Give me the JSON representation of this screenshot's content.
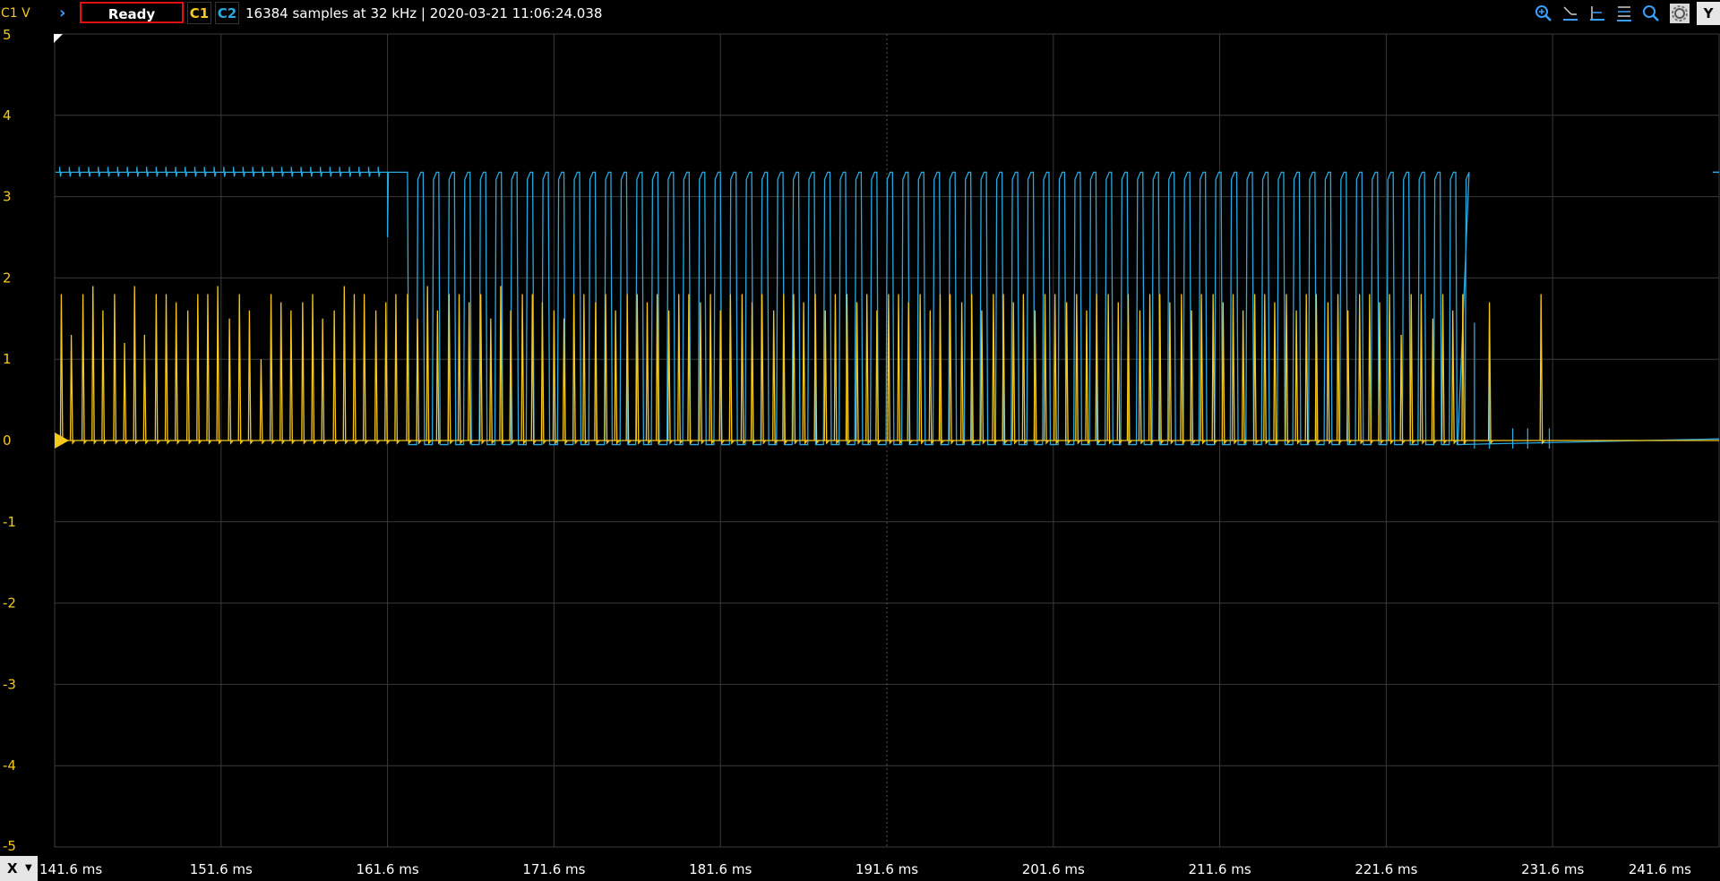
{
  "toolbar": {
    "channel_unit_label": "C1 V",
    "status_label": "Ready",
    "c1_label": "C1",
    "c2_label": "C2",
    "acquisition_info": "16384 samples at 32 kHz | 2020-03-21 11:06:24.038",
    "icons": [
      "zoom-in-icon",
      "cursor-icon",
      "marker-icon",
      "list-icon",
      "search-icon",
      "settings-icon"
    ],
    "y_button_label": "Y",
    "x_button_label": "X"
  },
  "colors": {
    "c1": "#f5c81e",
    "c2": "#29a9e0",
    "grid": "#3a3a3a",
    "status_border": "#e01010"
  },
  "chart_data": {
    "type": "line",
    "xlabel": "",
    "ylabel": "C1 V",
    "ylim": [
      -5,
      5
    ],
    "xlim": [
      141.6,
      241.6
    ],
    "yticks": [
      5,
      4,
      3,
      2,
      1,
      0,
      -1,
      -2,
      -3,
      -4,
      -5
    ],
    "xticks": [
      "141.6 ms",
      "151.6 ms",
      "161.6 ms",
      "171.6 ms",
      "181.6 ms",
      "191.6 ms",
      "201.6 ms",
      "211.6 ms",
      "221.6 ms",
      "231.6 ms",
      "241.6 ms"
    ],
    "grid": true,
    "series": [
      {
        "channel": "C1",
        "baseline": 0,
        "pulse_times_ms": [
          142.0,
          142.6,
          143.3,
          143.9,
          144.5,
          145.2,
          145.8,
          146.4,
          147.0,
          147.7,
          148.3,
          148.9,
          149.6,
          150.2,
          150.8,
          151.4,
          152.1,
          152.7,
          153.3,
          154.0,
          154.6,
          155.2,
          155.8,
          156.5,
          157.1,
          157.7,
          158.4,
          159.0,
          159.6,
          160.2,
          160.9,
          161.5,
          162.1,
          162.8,
          163.4,
          164.0,
          164.6,
          165.3,
          165.9,
          166.5,
          167.2,
          167.8,
          168.4,
          169.0,
          169.7,
          170.3,
          170.9,
          171.6,
          172.2,
          172.8,
          173.4,
          174.1,
          174.7,
          175.3,
          176.0,
          176.6,
          177.2,
          177.8,
          178.5,
          179.1,
          179.7,
          180.4,
          181.0,
          181.6,
          182.2,
          182.9,
          183.5,
          184.1,
          184.8,
          185.4,
          186.0,
          186.6,
          187.3,
          187.9,
          188.5,
          189.2,
          189.8,
          190.4,
          191.0,
          191.7,
          192.3,
          192.9,
          193.6,
          194.2,
          194.8,
          195.4,
          196.1,
          196.7,
          197.3,
          198.0,
          198.6,
          199.2,
          199.8,
          200.5,
          201.1,
          201.7,
          202.4,
          203.0,
          203.6,
          204.2,
          204.9,
          205.5,
          206.1,
          206.8,
          207.4,
          208.0,
          208.6,
          209.3,
          209.9,
          210.5,
          211.2,
          211.8,
          212.4,
          213.0,
          213.7,
          214.3,
          214.9,
          215.6,
          216.2,
          216.8,
          217.4,
          218.1,
          218.7,
          219.3,
          220.0,
          220.6,
          221.2,
          221.8,
          222.5,
          223.1,
          223.7,
          224.4,
          225.0,
          225.6,
          226.2,
          227.8,
          230.9
        ],
        "pulse_peaks_v": [
          1.8,
          1.3,
          1.8,
          1.9,
          1.6,
          1.8,
          1.2,
          1.9,
          1.3,
          1.8,
          1.8,
          1.7,
          1.6,
          1.8,
          1.8,
          1.9,
          1.5,
          1.8,
          1.6,
          1.0,
          1.8,
          1.7,
          1.6,
          1.7,
          1.8,
          1.5,
          1.6,
          1.9,
          1.8,
          1.8,
          1.6,
          1.7,
          1.8,
          1.8,
          1.5,
          1.9,
          1.6,
          1.8,
          1.8,
          1.7,
          1.8,
          1.5,
          1.9,
          1.6,
          1.8,
          1.8,
          1.7,
          1.6,
          1.5,
          1.8,
          1.8,
          1.7,
          1.8,
          1.6,
          1.8,
          1.8,
          1.7,
          1.8,
          1.6,
          1.8,
          1.8,
          1.7,
          1.8,
          1.6,
          1.8,
          1.8,
          1.7,
          1.8,
          1.6,
          1.8,
          1.8,
          1.7,
          1.8,
          1.6,
          1.8,
          1.8,
          1.7,
          1.8,
          1.6,
          1.8,
          1.8,
          1.7,
          1.8,
          1.6,
          1.8,
          1.8,
          1.7,
          1.8,
          1.6,
          1.8,
          1.8,
          1.7,
          1.8,
          1.6,
          1.8,
          1.8,
          1.7,
          1.8,
          1.6,
          1.8,
          1.8,
          1.7,
          1.8,
          1.6,
          1.8,
          1.8,
          1.7,
          1.8,
          1.6,
          1.8,
          1.8,
          1.7,
          1.8,
          1.6,
          1.8,
          1.8,
          1.7,
          1.8,
          1.6,
          1.8,
          1.8,
          1.7,
          1.8,
          1.6,
          1.8,
          1.8,
          1.7,
          1.8,
          1.3,
          1.8,
          1.8,
          1.5,
          1.8,
          1.6,
          1.8,
          1.7,
          1.8,
          1.5
        ]
      },
      {
        "channel": "C2",
        "high_v": 3.3,
        "low_v": -0.05,
        "ripple_until_ms": 161.6,
        "first_dip_ms": 161.6,
        "pulse_start_ms": 162.8,
        "pulse_end_ms": 225.9,
        "pulse_period_ms": 0.94,
        "tail_spikes_ms": [
          226.9,
          227.8,
          229.2,
          230.1,
          231.4
        ]
      }
    ]
  }
}
